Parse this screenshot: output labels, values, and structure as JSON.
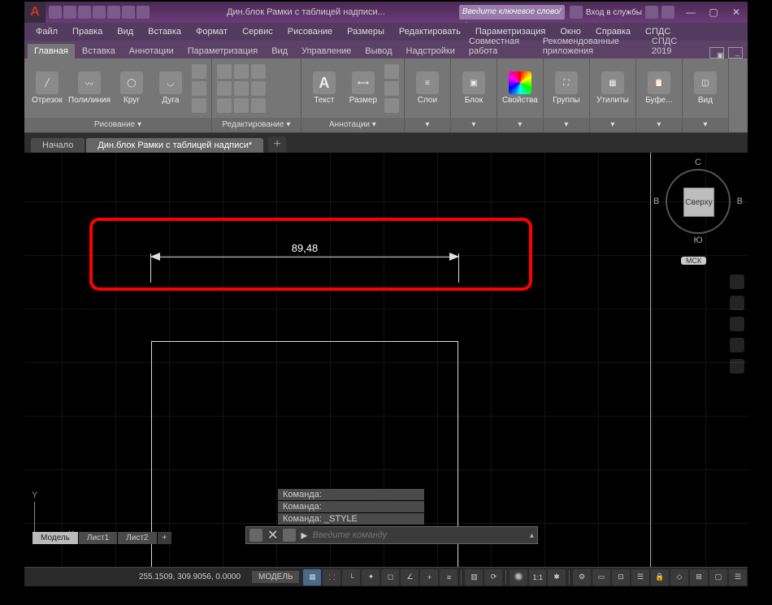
{
  "title": "Дин.блок Рамки с таблицей надписи...",
  "search_placeholder": "Введите ключевое слово/фразу",
  "login_label": "Вход в службы",
  "menu": [
    "Файл",
    "Правка",
    "Вид",
    "Вставка",
    "Формат",
    "Сервис",
    "Рисование",
    "Размеры",
    "Редактировать",
    "Параметризация",
    "Окно",
    "Справка",
    "СПДС"
  ],
  "ribbon_tabs": [
    "Главная",
    "Вставка",
    "Аннотации",
    "Параметризация",
    "Вид",
    "Управление",
    "Вывод",
    "Надстройки",
    "Совместная работа",
    "Рекомендованные приложения",
    "СПДС 2019"
  ],
  "ribbon_tab_active": 0,
  "panels": {
    "draw": {
      "label": "Рисование ▾",
      "items": [
        "Отрезок",
        "Полилиния",
        "Круг",
        "Дуга"
      ]
    },
    "edit": {
      "label": "Редактирование ▾"
    },
    "annot": {
      "label": "Аннотации ▾",
      "items": [
        "Текст",
        "Размер"
      ]
    },
    "layers": {
      "label": "Слои"
    },
    "block": {
      "label": "Блок"
    },
    "props": {
      "label": "Свойства"
    },
    "groups": {
      "label": "Группы"
    },
    "utils": {
      "label": "Утилиты"
    },
    "clipboard": {
      "label": "Буфе..."
    },
    "view": {
      "label": "Вид"
    }
  },
  "doc_tabs": {
    "items": [
      "Начало",
      "Дин.блок Рамки с таблицей надписи*"
    ],
    "active": 1
  },
  "dimension_value": "89,48",
  "viewcube": {
    "top": "Сверху",
    "n": "С",
    "s": "Ю",
    "e": "В",
    "w": "В",
    "msk": "МСК"
  },
  "ucs": {
    "x": "X",
    "y": "Y"
  },
  "cmd_history": [
    "Команда:",
    "Команда:",
    "Команда: _STYLE"
  ],
  "cmd_placeholder": "Введите команду",
  "layout_tabs": {
    "items": [
      "Модель",
      "Лист1",
      "Лист2"
    ],
    "active": 0
  },
  "status": {
    "coords": "255.1509, 309.9056, 0.0000",
    "model": "МОДЕЛЬ",
    "scale": "1:1"
  }
}
